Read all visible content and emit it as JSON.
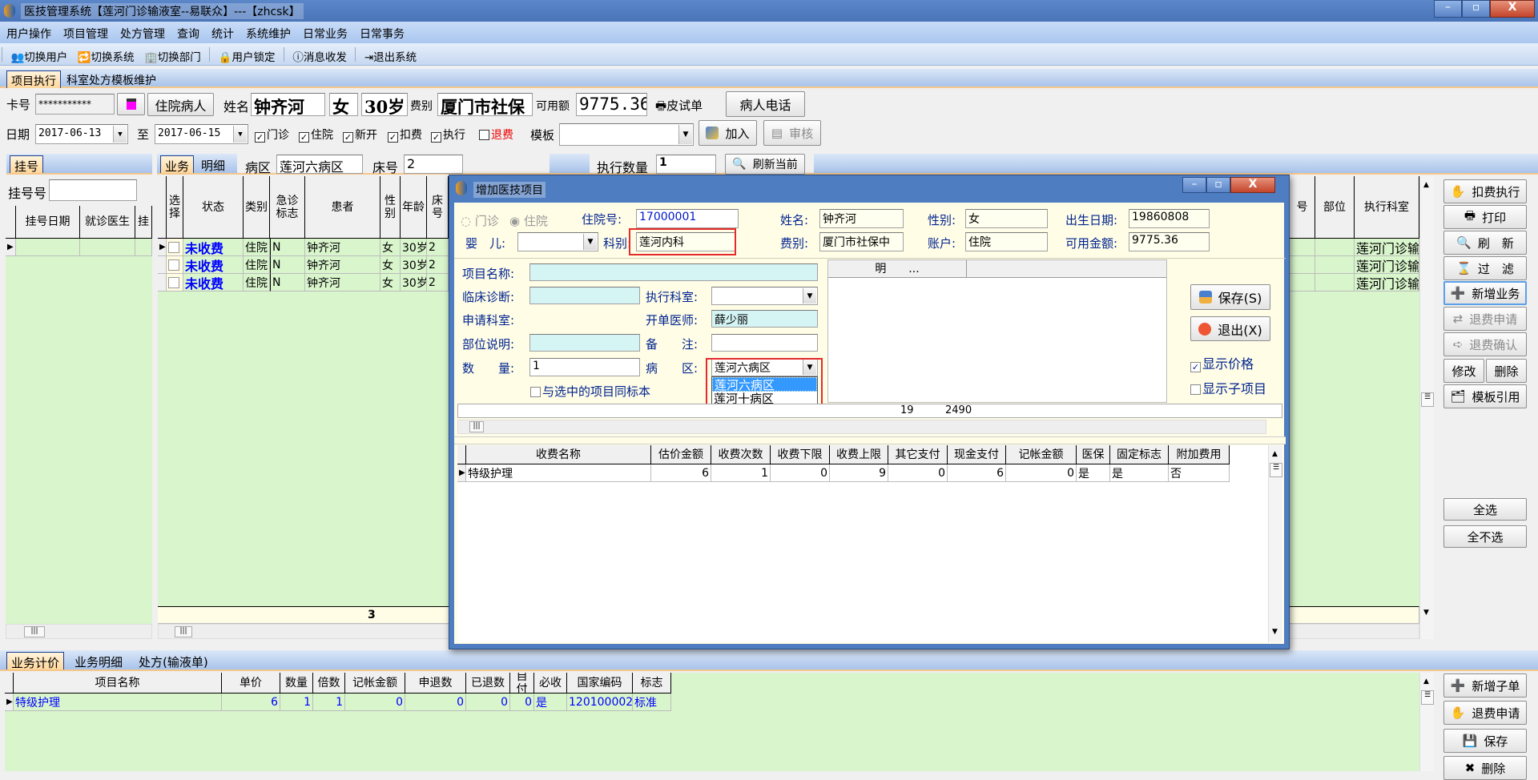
{
  "window": {
    "title": "医技管理系统【莲河门诊输液室--易联众】---【zhcsk】"
  },
  "menu": [
    "用户操作",
    "项目管理",
    "处方管理",
    "查询",
    "统计",
    "系统维护",
    "日常业务",
    "日常事务"
  ],
  "toolbar": [
    "切换用户",
    "切换系统",
    "切换部门",
    "用户锁定",
    "消息收发",
    "退出系统"
  ],
  "main_tabs": [
    "项目执行",
    "科室处方模板维护"
  ],
  "patient": {
    "card_label": "卡号",
    "card_value": "***********",
    "type_button": "住院病人",
    "name_label": "姓名",
    "name": "钟齐河",
    "sex": "女",
    "age": "30岁",
    "fee_label": "费别",
    "fee_type": "厦门市社保",
    "balance_label": "可用额",
    "balance": "9775.36",
    "skin_test": "皮试单",
    "phone_button": "病人电话"
  },
  "filter": {
    "date_label": "日期",
    "date_from": "2017-06-13",
    "to_label": "至",
    "date_to": "2017-06-15",
    "checks": [
      {
        "label": "门诊",
        "checked": true
      },
      {
        "label": "住院",
        "checked": true
      },
      {
        "label": "新开",
        "checked": true
      },
      {
        "label": "扣费",
        "checked": true
      },
      {
        "label": "执行",
        "checked": true
      },
      {
        "label": "退费",
        "checked": false
      }
    ],
    "template_label": "模板",
    "template_value": "",
    "add_button": "加入",
    "review_button": "审核"
  },
  "left": {
    "tab": "挂号",
    "reg_label": "挂号号",
    "reg_value": "",
    "columns": [
      "挂号日期",
      "就诊医生",
      "挂"
    ]
  },
  "center": {
    "tabs": [
      "业务",
      "明细"
    ],
    "ward_label": "病区",
    "ward": "莲河六病区",
    "bed_label": "床号",
    "bed": "2",
    "exec_qty_label": "执行数量",
    "exec_qty": "1",
    "refresh_current": "刷新当前",
    "columns": [
      "选择",
      "状态",
      "类别",
      "急诊标志",
      "患者",
      "性别",
      "年龄",
      "床号"
    ],
    "right_columns": [
      "号",
      "部位",
      "执行科室"
    ],
    "rows": [
      [
        "",
        "未收费",
        "住院",
        "N",
        "钟齐河",
        "女",
        "30岁",
        "2"
      ],
      [
        "",
        "未收费",
        "住院",
        "N",
        "钟齐河",
        "女",
        "30岁",
        "2"
      ],
      [
        "",
        "未收费",
        "住院",
        "N",
        "钟齐河",
        "女",
        "30岁",
        "2"
      ]
    ],
    "right_rows": [
      [
        "",
        "",
        "莲河门诊输"
      ],
      [
        "",
        "",
        "莲河门诊输"
      ],
      [
        "",
        "",
        "莲河门诊输"
      ]
    ],
    "footer_count": "3"
  },
  "right_buttons": [
    "扣费执行",
    "打印",
    "刷　新",
    "过　滤",
    "新增业务",
    "退费申请",
    "退费确认",
    "修改",
    "删除",
    "模板引用"
  ],
  "select_buttons": [
    "全选",
    "全不选"
  ],
  "bottom": {
    "tabs": [
      "业务计价",
      "业务明细",
      "处方(输液单)"
    ],
    "columns": [
      "项目名称",
      "单价",
      "数量",
      "倍数",
      "记帐金额",
      "申退数",
      "已退数",
      "自付",
      "必收",
      "国家编码",
      "标志"
    ],
    "rows": [
      [
        "特级护理",
        "6",
        "1",
        "1",
        "0",
        "0",
        "0",
        "0",
        "是",
        "120100002",
        "标准"
      ]
    ],
    "buttons": [
      "新增子单",
      "退费申请",
      "保存",
      "删除"
    ]
  },
  "dialog": {
    "title": "增加医技项目",
    "radio_outpatient": "门诊",
    "radio_inpatient": "住院",
    "inpatient_no_label": "住院号:",
    "inpatient_no": "17000001",
    "name_label": "姓名:",
    "name": "钟齐河",
    "sex_label": "性别:",
    "sex": "女",
    "birth_label": "出生日期:",
    "birth": "19860808",
    "baby_label": "婴　儿:",
    "baby": "",
    "dept_label": "科别:",
    "dept": "莲河内科",
    "fee_label": "费别:",
    "fee": "厦门市社保中",
    "account_label": "账户:",
    "account": "住院",
    "balance_label": "可用金额:",
    "balance": "9775.36",
    "item_label": "项目名称:",
    "item": "",
    "diag_label": "临床诊断:",
    "diag": "",
    "exec_dept_label": "执行科室:",
    "exec_dept": "",
    "apply_dept_label": "申请科室:",
    "doctor_label": "开单医师:",
    "doctor": "薛少丽",
    "part_label": "部位说明:",
    "part": "",
    "remark_label": "备　　注:",
    "remark": "",
    "qty_label": "数　　量:",
    "qty": "1",
    "ward_label": "病　　区:",
    "ward": "莲河六病区",
    "ward_options": [
      "莲河六病区",
      "莲河十病区"
    ],
    "same_sample": "与选中的项目同标本",
    "list_header": [
      "明　　...",
      ""
    ],
    "save": "保存(S)",
    "exit": "退出(X)",
    "show_price": "显示价格",
    "show_price_checked": true,
    "show_sub": "显示子项目",
    "show_sub_checked": false,
    "strip_values": [
      "19",
      "2490"
    ],
    "fee_columns": [
      "收费名称",
      "估价金额",
      "收费次数",
      "收费下限",
      "收费上限",
      "其它支付",
      "现金支付",
      "记帐金额",
      "医保",
      "固定标志",
      "附加费用"
    ],
    "fee_rows": [
      [
        "特级护理",
        "6",
        "1",
        "0",
        "9",
        "0",
        "6",
        "0",
        "是",
        "是",
        "否"
      ]
    ]
  },
  "colors": {
    "title": "#4a74b8",
    "grid": "#d9f5cc",
    "status_blue": "#0000ff",
    "highlight": "#e52a2a",
    "selected": "#3399ff"
  }
}
